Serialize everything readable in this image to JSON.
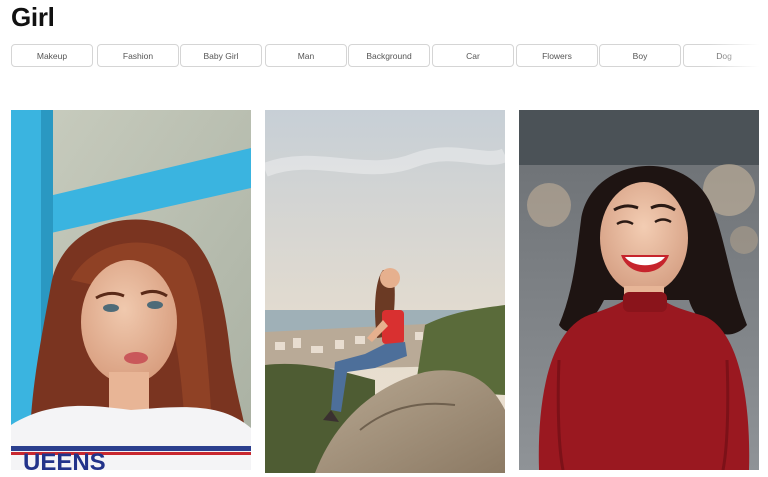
{
  "page": {
    "title": "Girl"
  },
  "tags": [
    {
      "label": "Makeup"
    },
    {
      "label": "Fashion"
    },
    {
      "label": "Baby Girl"
    },
    {
      "label": "Man"
    },
    {
      "label": "Background"
    },
    {
      "label": "Car"
    },
    {
      "label": "Flowers"
    },
    {
      "label": "Boy"
    },
    {
      "label": "Dog"
    }
  ],
  "photos": [
    {
      "subject": "red-haired-woman-portrait-photo",
      "shirt_text": "UEENS"
    },
    {
      "subject": "woman-sitting-on-rock-photo"
    },
    {
      "subject": "smiling-woman-red-top-photo"
    }
  ],
  "colors": {
    "title": "#111111",
    "tag_border": "#d5d5d5",
    "tag_text": "#555555",
    "background": "#ffffff"
  }
}
